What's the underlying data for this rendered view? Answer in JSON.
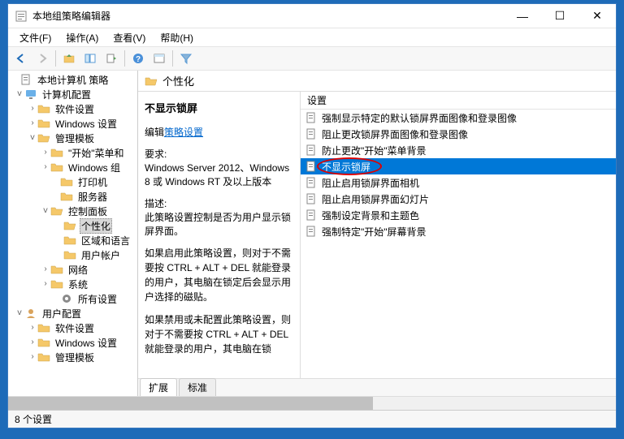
{
  "window": {
    "title": "本地组策略编辑器",
    "min": "—",
    "max": "☐",
    "close": "✕"
  },
  "menu": {
    "file": "文件(F)",
    "action": "操作(A)",
    "view": "查看(V)",
    "help": "帮助(H)"
  },
  "tree": {
    "root": "本地计算机 策略",
    "computer_config": "计算机配置",
    "software_settings": "软件设置",
    "windows_settings": "Windows 设置",
    "admin_templates": "管理模板",
    "start_menu": "\"开始\"菜单和",
    "windows_components": "Windows 组",
    "printers": "打印机",
    "servers": "服务器",
    "control_panel": "控制面板",
    "personalization": "个性化",
    "region_lang": "区域和语言",
    "user_accounts": "用户帐户",
    "network": "网络",
    "system": "系统",
    "all_settings": "所有设置",
    "user_config": "用户配置",
    "u_software_settings": "软件设置",
    "u_windows_settings": "Windows 设置",
    "u_admin_templates": "管理模板"
  },
  "path": "个性化",
  "details": {
    "title": "不显示锁屏",
    "edit_prefix": "编辑",
    "edit_link": "策略设置",
    "req_label": "要求:",
    "req_text": "Windows Server 2012、Windows 8 或 Windows RT 及以上版本",
    "desc_label": "描述:",
    "desc_text": "此策略设置控制是否为用户显示锁屏界面。",
    "para1": "如果启用此策略设置，则对于不需要按 CTRL + ALT + DEL 就能登录的用户，其电脑在锁定后会显示用户选择的磁贴。",
    "para2": "如果禁用或未配置此策略设置，则对于不需要按 CTRL + ALT + DEL 就能登录的用户，其电脑在锁"
  },
  "list": {
    "header": "设置",
    "items": [
      "强制显示特定的默认锁屏界面图像和登录图像",
      "阻止更改锁屏界面图像和登录图像",
      "防止更改\"开始\"菜单背景",
      "不显示锁屏",
      "阻止启用锁屏界面相机",
      "阻止启用锁屏界面幻灯片",
      "强制设定背景和主题色",
      "强制特定\"开始\"屏幕背景"
    ],
    "selected_index": 3
  },
  "tabs": {
    "extended": "扩展",
    "standard": "标准"
  },
  "status": "8 个设置"
}
